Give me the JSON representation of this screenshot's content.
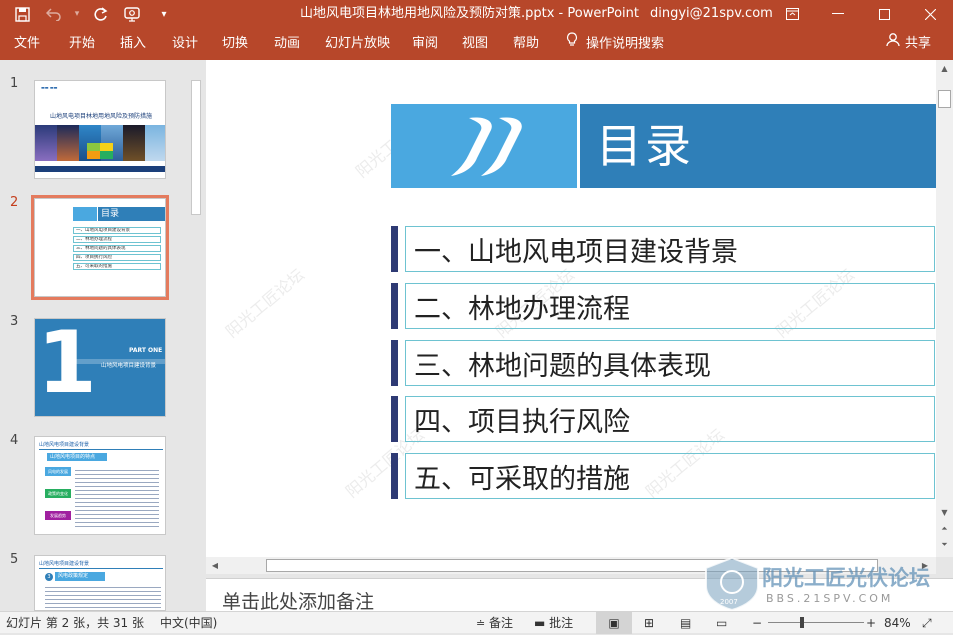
{
  "titlebar": {
    "doc_title": "山地风电项目林地用地风险及预防对策.pptx  -  PowerPoint",
    "user": "dingyi@21spv.com",
    "icons": [
      "save-icon",
      "undo-icon",
      "redo-icon",
      "present-icon",
      "customize-icon"
    ]
  },
  "menu": {
    "items": [
      "文件",
      "开始",
      "插入",
      "设计",
      "切换",
      "动画",
      "幻灯片放映",
      "审阅",
      "视图",
      "帮助",
      "操作说明搜索"
    ],
    "share": "共享"
  },
  "thumbnails": {
    "numbers": [
      "1",
      "2",
      "3",
      "4",
      "5"
    ],
    "slide1_title": "山地风电项目林地用地风险及预防措施",
    "slide2_header": "目录",
    "slide2_items": [
      "一、山地风电项目建设背景",
      "二、林地办理流程",
      "三、林地问题的具体表现",
      "四、项目执行风险",
      "五、可采取的措施"
    ],
    "slide3_number": "1",
    "slide3_part": "PART ONE",
    "slide3_caption": "山地风电项目建设背景",
    "slide4_header": "山地风电项目建设背景",
    "slide4_sub": "山地风电项目的特点",
    "slide4_tags": [
      "风电的发展",
      "政策的变化",
      "发展趋势"
    ],
    "slide5_header": "山地风电项目建设背景",
    "slide5_sub": "风电政策规定",
    "slide5_num": "3"
  },
  "slide": {
    "title": "目录",
    "items": [
      "一、山地风电项目建设背景",
      "二、林地办理流程",
      "三、林地问题的具体表现",
      "四、项目执行风险",
      "五、可采取的措施"
    ],
    "watermark": "阳光工匠论坛"
  },
  "notes": {
    "placeholder": "单击此处添加备注"
  },
  "status": {
    "slide_info": "幻灯片 第 2 张，共 31 张",
    "language": "中文(中国)",
    "notes": "备注",
    "comments": "批注",
    "zoom": "84%"
  },
  "brand": {
    "name": "阳光工匠光伏论坛",
    "url": "BBS.21SPV.COM",
    "year": "2007"
  },
  "colors": {
    "accent": "#b7472a",
    "slide_light_blue": "#4aa8e0",
    "slide_dark_blue": "#2f7fb8",
    "item_bar": "#2e3a74",
    "item_border": "#6ec3d1",
    "active_thumb": "#e47b5e"
  }
}
